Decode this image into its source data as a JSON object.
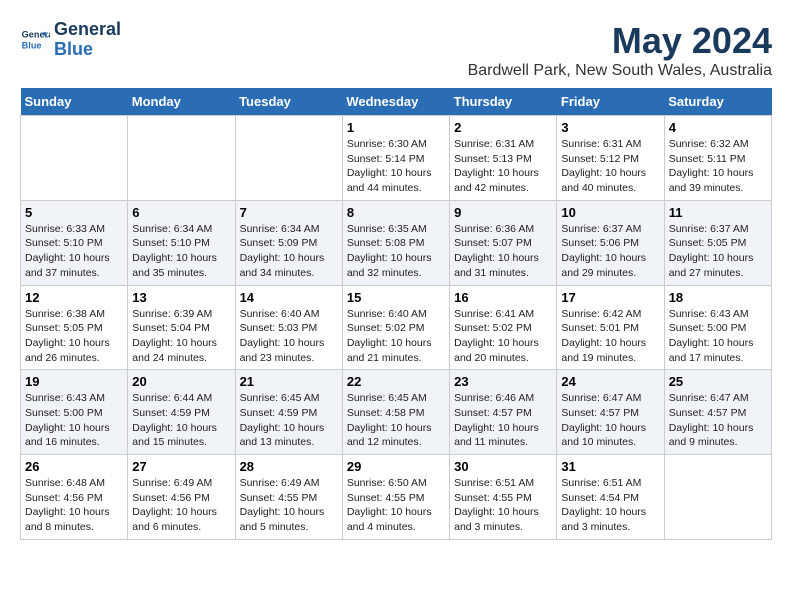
{
  "header": {
    "logo_line1": "General",
    "logo_line2": "Blue",
    "title": "May 2024",
    "subtitle": "Bardwell Park, New South Wales, Australia"
  },
  "calendar": {
    "days_of_week": [
      "Sunday",
      "Monday",
      "Tuesday",
      "Wednesday",
      "Thursday",
      "Friday",
      "Saturday"
    ],
    "weeks": [
      [
        {
          "day": "",
          "info": ""
        },
        {
          "day": "",
          "info": ""
        },
        {
          "day": "",
          "info": ""
        },
        {
          "day": "1",
          "info": "Sunrise: 6:30 AM\nSunset: 5:14 PM\nDaylight: 10 hours\nand 44 minutes."
        },
        {
          "day": "2",
          "info": "Sunrise: 6:31 AM\nSunset: 5:13 PM\nDaylight: 10 hours\nand 42 minutes."
        },
        {
          "day": "3",
          "info": "Sunrise: 6:31 AM\nSunset: 5:12 PM\nDaylight: 10 hours\nand 40 minutes."
        },
        {
          "day": "4",
          "info": "Sunrise: 6:32 AM\nSunset: 5:11 PM\nDaylight: 10 hours\nand 39 minutes."
        }
      ],
      [
        {
          "day": "5",
          "info": "Sunrise: 6:33 AM\nSunset: 5:10 PM\nDaylight: 10 hours\nand 37 minutes."
        },
        {
          "day": "6",
          "info": "Sunrise: 6:34 AM\nSunset: 5:10 PM\nDaylight: 10 hours\nand 35 minutes."
        },
        {
          "day": "7",
          "info": "Sunrise: 6:34 AM\nSunset: 5:09 PM\nDaylight: 10 hours\nand 34 minutes."
        },
        {
          "day": "8",
          "info": "Sunrise: 6:35 AM\nSunset: 5:08 PM\nDaylight: 10 hours\nand 32 minutes."
        },
        {
          "day": "9",
          "info": "Sunrise: 6:36 AM\nSunset: 5:07 PM\nDaylight: 10 hours\nand 31 minutes."
        },
        {
          "day": "10",
          "info": "Sunrise: 6:37 AM\nSunset: 5:06 PM\nDaylight: 10 hours\nand 29 minutes."
        },
        {
          "day": "11",
          "info": "Sunrise: 6:37 AM\nSunset: 5:05 PM\nDaylight: 10 hours\nand 27 minutes."
        }
      ],
      [
        {
          "day": "12",
          "info": "Sunrise: 6:38 AM\nSunset: 5:05 PM\nDaylight: 10 hours\nand 26 minutes."
        },
        {
          "day": "13",
          "info": "Sunrise: 6:39 AM\nSunset: 5:04 PM\nDaylight: 10 hours\nand 24 minutes."
        },
        {
          "day": "14",
          "info": "Sunrise: 6:40 AM\nSunset: 5:03 PM\nDaylight: 10 hours\nand 23 minutes."
        },
        {
          "day": "15",
          "info": "Sunrise: 6:40 AM\nSunset: 5:02 PM\nDaylight: 10 hours\nand 21 minutes."
        },
        {
          "day": "16",
          "info": "Sunrise: 6:41 AM\nSunset: 5:02 PM\nDaylight: 10 hours\nand 20 minutes."
        },
        {
          "day": "17",
          "info": "Sunrise: 6:42 AM\nSunset: 5:01 PM\nDaylight: 10 hours\nand 19 minutes."
        },
        {
          "day": "18",
          "info": "Sunrise: 6:43 AM\nSunset: 5:00 PM\nDaylight: 10 hours\nand 17 minutes."
        }
      ],
      [
        {
          "day": "19",
          "info": "Sunrise: 6:43 AM\nSunset: 5:00 PM\nDaylight: 10 hours\nand 16 minutes."
        },
        {
          "day": "20",
          "info": "Sunrise: 6:44 AM\nSunset: 4:59 PM\nDaylight: 10 hours\nand 15 minutes."
        },
        {
          "day": "21",
          "info": "Sunrise: 6:45 AM\nSunset: 4:59 PM\nDaylight: 10 hours\nand 13 minutes."
        },
        {
          "day": "22",
          "info": "Sunrise: 6:45 AM\nSunset: 4:58 PM\nDaylight: 10 hours\nand 12 minutes."
        },
        {
          "day": "23",
          "info": "Sunrise: 6:46 AM\nSunset: 4:57 PM\nDaylight: 10 hours\nand 11 minutes."
        },
        {
          "day": "24",
          "info": "Sunrise: 6:47 AM\nSunset: 4:57 PM\nDaylight: 10 hours\nand 10 minutes."
        },
        {
          "day": "25",
          "info": "Sunrise: 6:47 AM\nSunset: 4:57 PM\nDaylight: 10 hours\nand 9 minutes."
        }
      ],
      [
        {
          "day": "26",
          "info": "Sunrise: 6:48 AM\nSunset: 4:56 PM\nDaylight: 10 hours\nand 8 minutes."
        },
        {
          "day": "27",
          "info": "Sunrise: 6:49 AM\nSunset: 4:56 PM\nDaylight: 10 hours\nand 6 minutes."
        },
        {
          "day": "28",
          "info": "Sunrise: 6:49 AM\nSunset: 4:55 PM\nDaylight: 10 hours\nand 5 minutes."
        },
        {
          "day": "29",
          "info": "Sunrise: 6:50 AM\nSunset: 4:55 PM\nDaylight: 10 hours\nand 4 minutes."
        },
        {
          "day": "30",
          "info": "Sunrise: 6:51 AM\nSunset: 4:55 PM\nDaylight: 10 hours\nand 3 minutes."
        },
        {
          "day": "31",
          "info": "Sunrise: 6:51 AM\nSunset: 4:54 PM\nDaylight: 10 hours\nand 3 minutes."
        },
        {
          "day": "",
          "info": ""
        }
      ]
    ]
  }
}
